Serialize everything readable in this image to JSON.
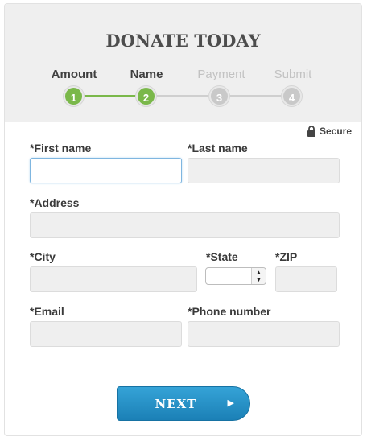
{
  "title": "DONATE TODAY",
  "steps": [
    {
      "label": "Amount",
      "number": "1",
      "state": "complete"
    },
    {
      "label": "Name",
      "number": "2",
      "state": "current"
    },
    {
      "label": "Payment",
      "number": "3",
      "state": "inactive"
    },
    {
      "label": "Submit",
      "number": "4",
      "state": "inactive"
    }
  ],
  "secure_label": "Secure",
  "fields": {
    "first_name": {
      "label": "*First name",
      "value": ""
    },
    "last_name": {
      "label": "*Last name",
      "value": ""
    },
    "address": {
      "label": "*Address",
      "value": ""
    },
    "city": {
      "label": "*City",
      "value": ""
    },
    "state": {
      "label": "*State",
      "value": ""
    },
    "zip": {
      "label": "*ZIP",
      "value": ""
    },
    "email": {
      "label": "*Email",
      "value": ""
    },
    "phone": {
      "label": "*Phone number",
      "value": ""
    }
  },
  "next_button": {
    "label": "NEXT",
    "arrow": "▶"
  },
  "colors": {
    "accent_green": "#7ab84a",
    "button_blue": "#1b80b6",
    "inactive_gray": "#c9c9c9"
  },
  "icons": {
    "secure": "lock-icon",
    "next": "arrow-right-icon"
  }
}
